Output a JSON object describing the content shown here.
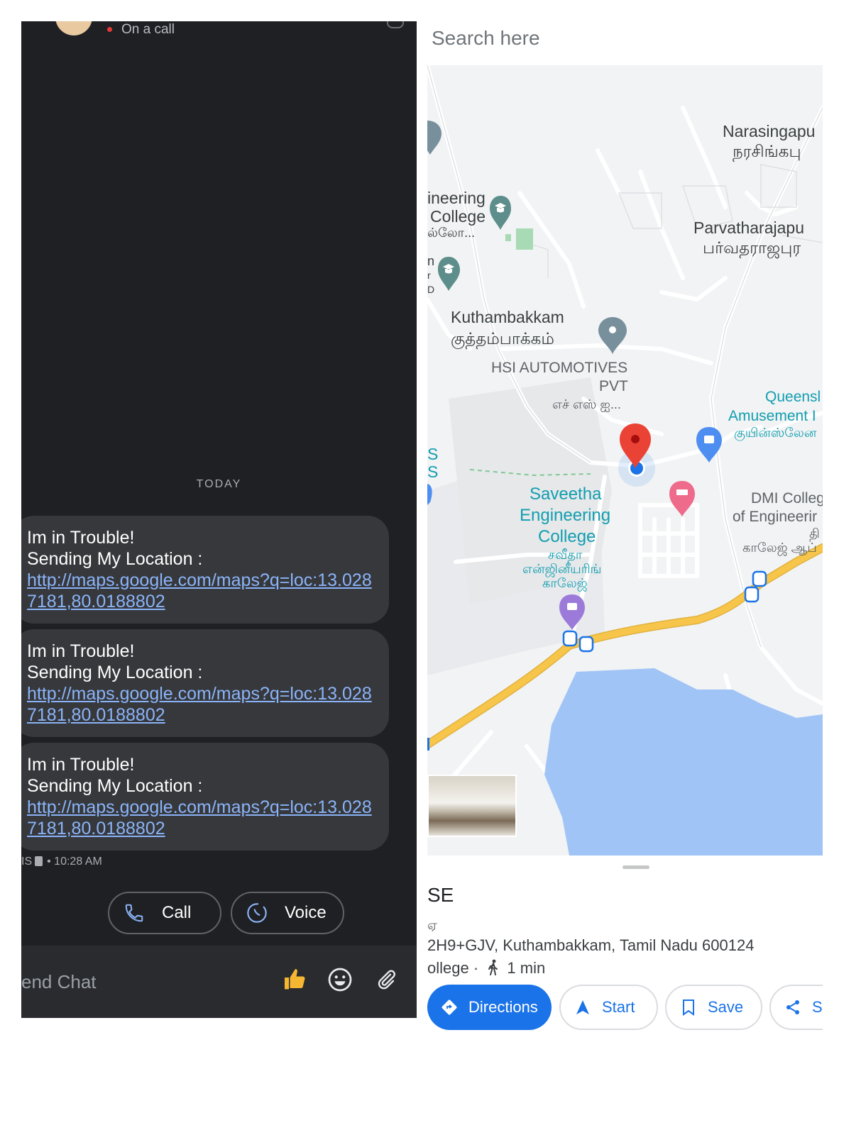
{
  "chat": {
    "status": "On a call",
    "day_divider": "TODAY",
    "messages": [
      {
        "line1": "Im in Trouble!",
        "line2": "Sending My Location :",
        "link": "http://maps.google.com/maps?q=loc:13.0287181,80.0188802"
      },
      {
        "line1": "Im in Trouble!",
        "line2": "Sending My Location :",
        "link": "http://maps.google.com/maps?q=loc:13.0287181,80.0188802"
      },
      {
        "line1": "Im in Trouble!",
        "line2": "Sending My Location :",
        "link": "http://maps.google.com/maps?q=loc:13.0287181,80.0188802"
      }
    ],
    "meta_prefix": "IS",
    "timestamp": "• 10:28 AM",
    "actions": {
      "call_label": "Call",
      "voice_label": "Voice"
    },
    "composer": {
      "placeholder": "end Chat",
      "icons": [
        "thumbs-up-icon",
        "emoji-icon",
        "attach-icon"
      ]
    }
  },
  "maps": {
    "search_placeholder": "Search here",
    "labels": {
      "narasingapuram_en": "Narasingapu",
      "narasingapuram_ta": "நரசிங்கபு",
      "eng_college_1": "ineering",
      "eng_college_2": "College",
      "eng_college_3": "ல்லோ...",
      "partial_1": "n",
      "partial_2": "r",
      "partial_3": "D",
      "parvatharajapuram_en": "Parvatharajapu",
      "parvatharajapuram_ta": "பர்வதராஜபுர",
      "kuthambakkam_en": "Kuthambakkam",
      "kuthambakkam_ta": "குத்தம்பாக்கம்",
      "hsi_1": "HSI AUTOMOTIVES",
      "hsi_2": "PVT",
      "hsi_3": "எச் எஸ் ஐ...",
      "queens_1": "Queensl",
      "queens_2": "Amusement I",
      "queens_3": "குயின்ஸ்லேன",
      "s_edge": "S",
      "saveetha_1": "Saveetha",
      "saveetha_2": "Engineering",
      "saveetha_3": "College",
      "saveetha_ta1": "சவீதா",
      "saveetha_ta2": "என்ஜினீயரிங்",
      "saveetha_ta3": "காலேஜ்",
      "dmi_1": "DMI Colleg",
      "dmi_2": "of Engineerir",
      "dmi_3": "தி",
      "dmi_4": "காலேஜ் ஆப்"
    },
    "place": {
      "title": "SE",
      "subtitle": "ஏ",
      "address": "2H9+GJV, Kuthambakkam, Tamil Nadu 600124",
      "category": "ollege ·",
      "walk_time": "1 min"
    },
    "buttons": {
      "directions": "Directions",
      "start": "Start",
      "save": "Save",
      "share": "SI"
    },
    "colors": {
      "water": "#a1c4f7",
      "highway": "#f6c54a",
      "accent": "#1a73e8",
      "pin": "#ea4335"
    }
  }
}
